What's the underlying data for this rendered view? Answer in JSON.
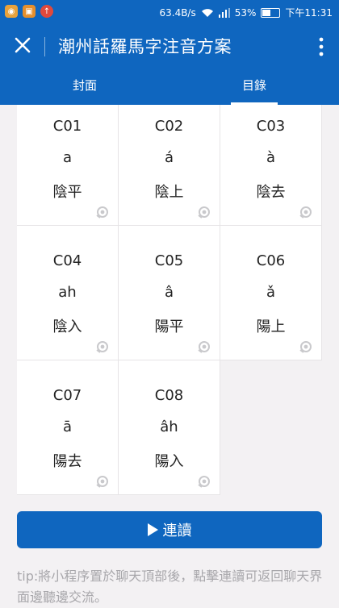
{
  "status_bar": {
    "speed": "63.4B/s",
    "battery": "53%",
    "battery_level": 0.53,
    "time": "下午11:31",
    "icons": [
      "weibo-icon",
      "app-icon",
      "upload-icon",
      "wifi-icon",
      "signal-icon",
      "battery-icon"
    ]
  },
  "app_bar": {
    "title": "潮州話羅馬字注音方案"
  },
  "tabs": [
    {
      "label": "封面",
      "active": false
    },
    {
      "label": "目錄",
      "active": true
    }
  ],
  "cells": [
    {
      "code": "C01",
      "roman": "a",
      "tone": "陰平"
    },
    {
      "code": "C02",
      "roman": "á",
      "tone": "陰上"
    },
    {
      "code": "C03",
      "roman": "à",
      "tone": "陰去"
    },
    {
      "code": "C04",
      "roman": "ah",
      "tone": "陰入"
    },
    {
      "code": "C05",
      "roman": "â",
      "tone": "陽平"
    },
    {
      "code": "C06",
      "roman": "ǎ",
      "tone": "陽上"
    },
    {
      "code": "C07",
      "roman": "ā",
      "tone": "陽去"
    },
    {
      "code": "C08",
      "roman": "âh",
      "tone": "陽入"
    }
  ],
  "continuous_read": {
    "label": "連讀"
  },
  "tip": "tip:將小程序置於聊天頂部後，點擊連讀可返回聊天界面邊聽邊交流。",
  "colors": {
    "primary": "#0f66bf",
    "background": "#f3f1f3",
    "tip_text": "#a8a7ab"
  }
}
